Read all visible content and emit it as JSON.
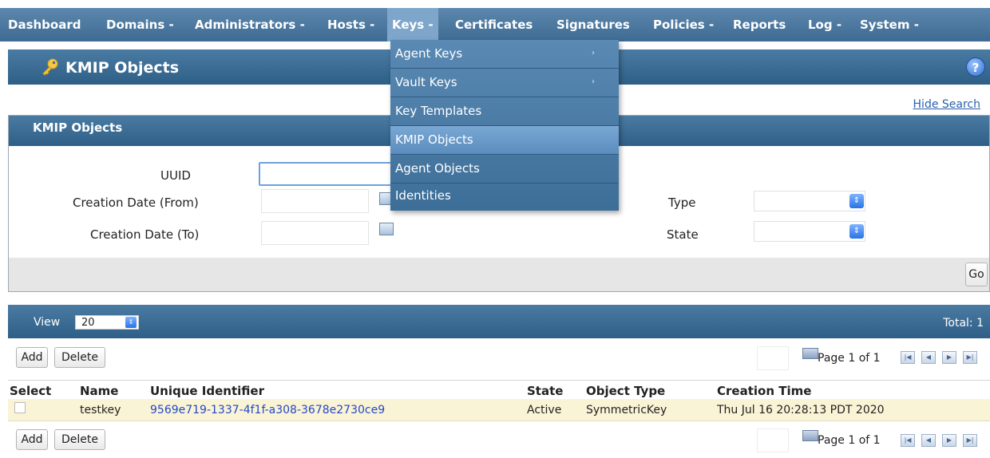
{
  "nav": {
    "items": [
      {
        "label": "Dashboard"
      },
      {
        "label": "Domains -"
      },
      {
        "label": "Administrators -"
      },
      {
        "label": "Hosts -"
      },
      {
        "label": "Keys -"
      },
      {
        "label": "Certificates"
      },
      {
        "label": "Signatures"
      },
      {
        "label": "Policies -"
      },
      {
        "label": "Reports"
      },
      {
        "label": "Log -"
      },
      {
        "label": "System -"
      }
    ]
  },
  "keys_menu": {
    "items": [
      {
        "label": "Agent Keys",
        "has_submenu": true
      },
      {
        "label": "Vault Keys",
        "has_submenu": true
      },
      {
        "label": "Key Templates",
        "has_submenu": false
      },
      {
        "label": "KMIP Objects",
        "has_submenu": false
      },
      {
        "label": "Agent Objects",
        "has_submenu": false
      },
      {
        "label": "Identities",
        "has_submenu": false
      }
    ],
    "arrow": "›"
  },
  "page": {
    "title": "KMIP Objects",
    "help": "?",
    "hide_search": "Hide Search"
  },
  "search": {
    "panel_title": "KMIP Objects",
    "uuid_label": "UUID",
    "uuid_value": "",
    "from_label": "Creation Date (From)",
    "to_label": "Creation Date (To)",
    "type_label": "Type",
    "state_label": "State",
    "type_value": "",
    "state_value": "",
    "go_label": "Go"
  },
  "results": {
    "view_label": "View",
    "view_value": "20",
    "total": "Total: 1",
    "add_label": "Add",
    "delete_label": "Delete",
    "page_text": "Page 1 of 1",
    "columns": [
      "Select",
      "Name",
      "Unique Identifier",
      "State",
      "Object Type",
      "Creation Time"
    ],
    "rows": [
      {
        "name": "testkey",
        "uid": "9569e719-1337-4f1f-a308-3678e2730ce9",
        "state": "Active",
        "object_type": "SymmetricKey",
        "created": "Thu Jul 16 20:28:13 PDT 2020"
      }
    ]
  },
  "colors": {
    "nav_bg": "#4a7ba3",
    "row_highlight": "#faf4d6",
    "link": "#2447c9"
  }
}
